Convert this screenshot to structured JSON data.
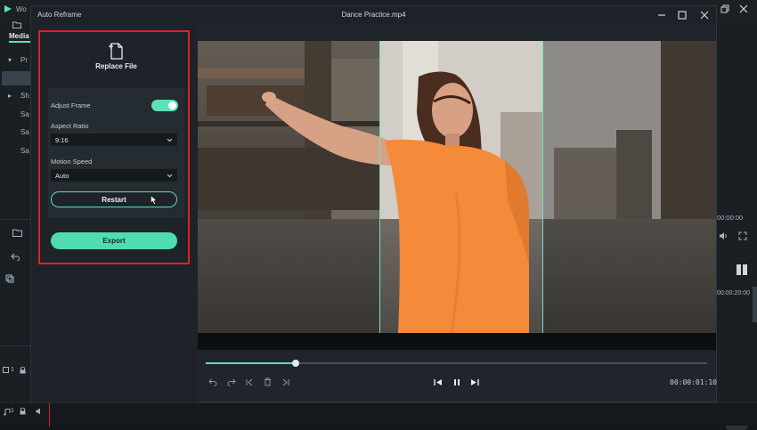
{
  "background_app": {
    "title_partial": "Wo",
    "tab_partial": "Media",
    "tree_items": [
      "Pr",
      "Sh",
      "Sa",
      "Sa",
      "Sa"
    ],
    "timecodes": [
      "00:00:00",
      "00:00:20:00"
    ],
    "tracks": [
      "1",
      "1"
    ]
  },
  "dialog": {
    "app_title": "Auto Reframe",
    "file_title": "Dance Practice.mp4",
    "window_buttons": [
      "minimize-icon",
      "maximize-icon",
      "close-icon"
    ]
  },
  "panel": {
    "replace_label": "Replace File",
    "adjust_frame_label": "Adjust Frame",
    "adjust_frame_on": true,
    "aspect_ratio_label": "Aspect Ratio",
    "aspect_ratio_value": "9:16",
    "motion_speed_label": "Motion Speed",
    "motion_speed_value": "Auto",
    "restart_label": "Restart",
    "export_label": "Export"
  },
  "player": {
    "progress": 0.18,
    "timecode": "00:00:01:10"
  },
  "colors": {
    "accent": "#4fdcb1",
    "highlight_border": "#d9222b",
    "shirt": "#f48a3a"
  }
}
